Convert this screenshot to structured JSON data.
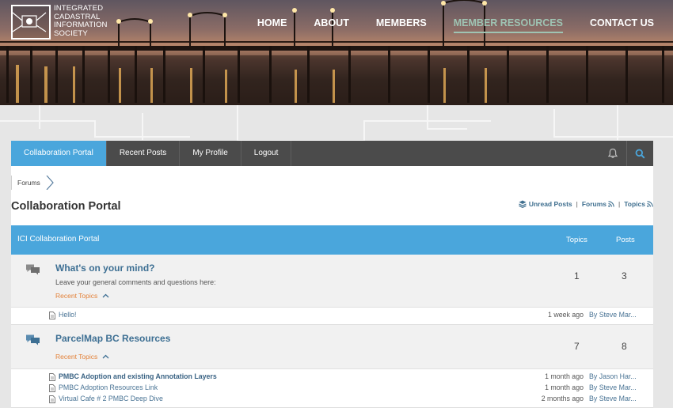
{
  "site": {
    "logo_lines": [
      "INTEGRATED",
      "CADASTRAL",
      "INFORMATION",
      "SOCIETY"
    ],
    "nav": [
      {
        "label": "HOME",
        "active": false
      },
      {
        "label": "ABOUT",
        "active": false
      },
      {
        "label": "MEMBERS",
        "active": false
      },
      {
        "label": "MEMBER RESOURCES",
        "active": true
      },
      {
        "label": "CONTACT US",
        "active": false
      }
    ]
  },
  "forum_nav": {
    "tabs": [
      {
        "label": "Collaboration Portal",
        "active": true
      },
      {
        "label": "Recent Posts",
        "active": false
      },
      {
        "label": "My Profile",
        "active": false
      },
      {
        "label": "Logout",
        "active": false
      }
    ],
    "icons": [
      "bell-icon",
      "search-icon"
    ]
  },
  "breadcrumb": [
    "Forums"
  ],
  "page_title": "Collaboration Portal",
  "util_links": {
    "unread": "Unread Posts",
    "forums": "Forums",
    "topics": "Topics",
    "separator": "|"
  },
  "forum_header": {
    "name": "ICI Collaboration Portal",
    "topics_col": "Topics",
    "posts_col": "Posts"
  },
  "forums": [
    {
      "title": "What's on your mind?",
      "description": "Leave your general comments and questions here:",
      "recent_label": "Recent Topics",
      "topics": "1",
      "posts": "3",
      "topic_list": [
        {
          "title": "Hello!",
          "date": "1 week ago",
          "by": "By Steve Mar...",
          "bold": false
        }
      ]
    },
    {
      "title": "ParcelMap BC Resources",
      "description": "",
      "recent_label": "Recent Topics",
      "topics": "7",
      "posts": "8",
      "topic_list": [
        {
          "title": "PMBC Adoption and existing Annotation Layers",
          "date": "1 month ago",
          "by": "By Jason Har...",
          "bold": true
        },
        {
          "title": "PMBC Adoption Resources Link",
          "date": "1 month ago",
          "by": "By Steve Mar...",
          "bold": false
        },
        {
          "title": "Virtual Cafe # 2 PMBC Deep Dive",
          "date": "2 months ago",
          "by": "By Steve Mar...",
          "bold": false
        }
      ]
    }
  ],
  "colors": {
    "accent": "#4aa6dc",
    "tabbar": "#4b4b4b",
    "link": "#3d6f93",
    "recent": "#e3823a",
    "nav_active": "#9fc4b3"
  }
}
